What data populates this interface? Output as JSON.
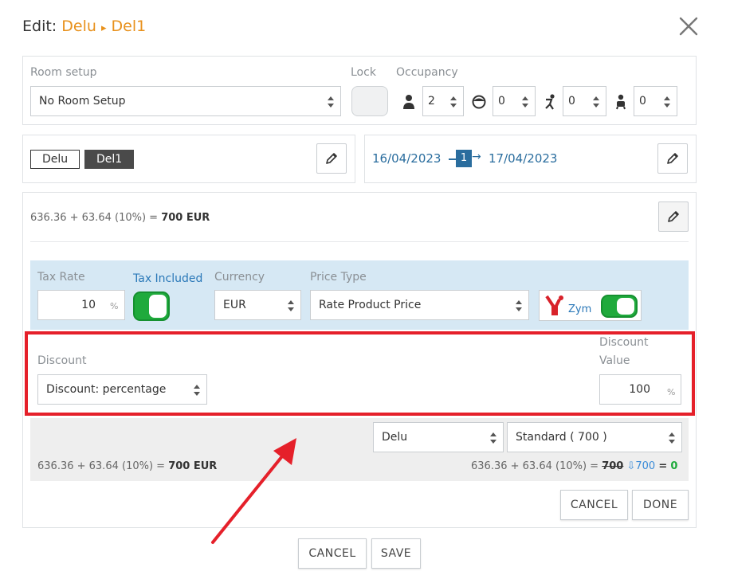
{
  "header": {
    "edit_label": "Edit:",
    "room_name": "Delu",
    "separator": "▸",
    "bed_name": "Del1"
  },
  "room_setup": {
    "label": "Room setup",
    "value": "No Room Setup",
    "lock_label": "Lock",
    "occupancy_label": "Occupancy",
    "occupancy": {
      "adults": "2",
      "children": "0",
      "kids": "0",
      "infants": "0"
    }
  },
  "assignment": {
    "room_tag": "Delu",
    "bed_tag": "Del1",
    "checkin": "16/04/2023",
    "nights": "1",
    "checkout": "17/04/2023"
  },
  "price_summary": {
    "base": "636.36 + 63.64 (10%) = ",
    "total": "700 EUR"
  },
  "pricing": {
    "tax_rate_label": "Tax Rate",
    "tax_rate_value": "10",
    "tax_unit": "%",
    "tax_included_label": "Tax Included",
    "currency_label": "Currency",
    "currency_value": "EUR",
    "price_type_label": "Price Type",
    "price_type_value": "Rate Product Price",
    "channel_label": "Zym"
  },
  "discount": {
    "label": "Discount",
    "type_value": "Discount: percentage",
    "value_label_line1": "Discount",
    "value_label_line2": "Value",
    "value": "100",
    "unit": "%"
  },
  "rate_row": {
    "room_select": "Delu",
    "rate_select": "Standard ( 700 )",
    "left_base": "636.36 + 63.64 (10%) = ",
    "left_total": "700 EUR",
    "right_base": "636.36 + 63.64 (10%) = ",
    "right_old": "700",
    "right_new": "700",
    "right_eq": "=",
    "right_diff": "0"
  },
  "inner_buttons": {
    "cancel": "CANCEL",
    "done": "DONE"
  },
  "footer_buttons": {
    "cancel": "CANCEL",
    "save": "SAVE"
  },
  "colors": {
    "accent_orange": "#e8911c",
    "link_blue": "#2a6d9e",
    "toggle_green": "#1faa3c",
    "highlight_red": "#e5202a",
    "pricing_bg": "#d6e8f4"
  }
}
